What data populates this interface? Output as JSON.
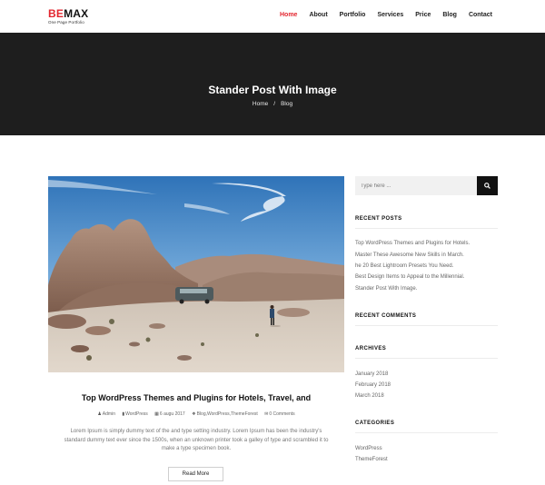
{
  "header": {
    "logo_be": "BE",
    "logo_max": "MAX",
    "logo_tagline": "One Page Portfolio",
    "nav": [
      "Home",
      "About",
      "Portfolio",
      "Services",
      "Price",
      "Blog",
      "Contact"
    ]
  },
  "hero": {
    "title": "Stander Post With Image",
    "breadcrumb_home": "Home",
    "breadcrumb_sep": "/",
    "breadcrumb_current": "Blog"
  },
  "post": {
    "title": "Top WordPress Themes and Plugins for Hotels, Travel, and",
    "meta_author": "Admin",
    "meta_category": "WordPress",
    "meta_date": "6 augu 2017",
    "meta_tags": "Blog,WordPress,ThemeForest",
    "meta_comments": "0 Comments",
    "excerpt": "Lorem Ipsum is simply dummy text of the and type setting industry. Lorem Ipsum has been the industry's standard dummy text ever since the 1500s, when an unknown printer took a galley of type and scrambled it to make a type specimen book.",
    "read_more": "Read More"
  },
  "sidebar": {
    "search_placeholder": "Type here ...",
    "recent_posts_title": "RECENT POSTS",
    "recent_posts": [
      "Top WordPress Themes and Plugins for Hotels.",
      "Master These Awesome New Skills in March.",
      "he 20 Best Lightroom Presets You Need.",
      "Best Design Items to Appeal to the Millennial.",
      "Stander Post With Image."
    ],
    "recent_comments_title": "RECENT COMMENTS",
    "archives_title": "ARCHIVES",
    "archives": [
      "January 2018",
      "February 2018",
      "March 2018"
    ],
    "categories_title": "CATEGORIES",
    "categories": [
      "WordPress",
      "ThemeForest"
    ]
  },
  "colors": {
    "accent": "#e3262f",
    "hero_bg": "#1e1e1e",
    "search_button": "#111111"
  }
}
